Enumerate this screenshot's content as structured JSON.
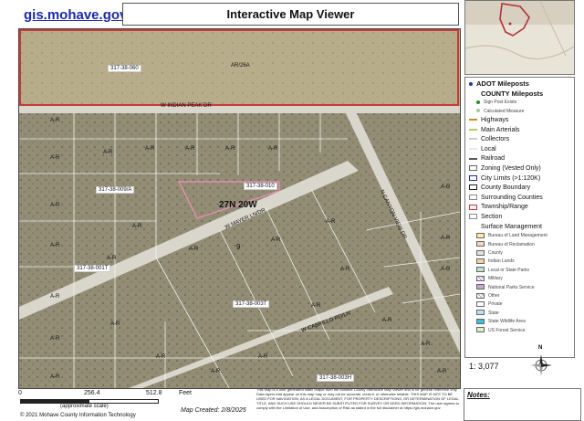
{
  "header": {
    "site_link": "gis.mohave.gov",
    "title": "Interactive Map Viewer"
  },
  "map": {
    "labels": {
      "parcel_top": "317-38-060",
      "ar26a": "AR/26A",
      "indian_peak": "W INDIAN PEAK DR",
      "parcel_010": "317-38-010",
      "parcel_mid": "317-38-009/A",
      "twp": "27N 20W",
      "mayer": "W MAYER LN/DR",
      "mohave_dr": "N CANYON VIEW DR",
      "parcel_011": "317-38-001T",
      "parcel_003": "317-38-003T",
      "cabrillo": "W CABRILLO RD/LN",
      "parcel_bottom": "317-38-003H",
      "section": "9",
      "ar": "A-R"
    }
  },
  "legend": {
    "items": [
      {
        "label": "ADOT Mileposts",
        "kind": "dot",
        "color": "#1a3aa8",
        "head": true
      },
      {
        "label": "COUNTY Mileposts",
        "kind": "none",
        "head": true
      },
      {
        "label": "Sign Post Exists",
        "kind": "dot",
        "color": "#2b8a2b",
        "sub": true
      },
      {
        "label": "Calculated Measure",
        "kind": "dot",
        "color": "#9acd9a",
        "sub": true
      },
      {
        "label": "Highways",
        "kind": "line",
        "color": "#d08a2a"
      },
      {
        "label": "Main Arterials",
        "kind": "line",
        "color": "#b7c96b"
      },
      {
        "label": "Collectors",
        "kind": "line",
        "color": "#cccccc"
      },
      {
        "label": "Local",
        "kind": "line",
        "color": "#e8e8e8"
      },
      {
        "label": "Railroad",
        "kind": "line",
        "color": "#555555"
      },
      {
        "label": "Zoning (Vested Only)",
        "kind": "box",
        "color": "#ffffff"
      },
      {
        "label": "City Limits (>1:120K)",
        "kind": "box",
        "color": "#ffffff",
        "border": "#1a2aa8"
      },
      {
        "label": "County Boundary",
        "kind": "box",
        "color": "#ffffff",
        "border": "#222222"
      },
      {
        "label": "Surrounding Counties",
        "kind": "box",
        "color": "#ffffff",
        "border": "#888888"
      },
      {
        "label": "Township/Range",
        "kind": "box",
        "color": "#ffffff",
        "border": "#cc3333"
      },
      {
        "label": "Section",
        "kind": "box",
        "color": "#ffffff",
        "border": "#888888"
      },
      {
        "label": "Surface Management",
        "kind": "none"
      },
      {
        "label": "Bureau of Land Management",
        "kind": "box",
        "color": "#fde9a8",
        "sub": true
      },
      {
        "label": "Bureau of Reclamation",
        "kind": "box",
        "color": "#fcd3b8",
        "sub": true
      },
      {
        "label": "County",
        "kind": "box",
        "color": "#e3e3e3",
        "sub": true
      },
      {
        "label": "Indian Lands",
        "kind": "box",
        "color": "#f6d2a2",
        "sub": true
      },
      {
        "label": "Local or State Parks",
        "kind": "box",
        "color": "#bfe3c8",
        "sub": true
      },
      {
        "label": "Military",
        "kind": "hatch",
        "color": "#b58ad8",
        "sub": true
      },
      {
        "label": "National Parks Service",
        "kind": "box",
        "color": "#c8a6d4",
        "sub": true
      },
      {
        "label": "Other",
        "kind": "hatch",
        "color": "#aaaaaa",
        "sub": true
      },
      {
        "label": "Private",
        "kind": "box",
        "color": "#ffffff",
        "sub": true
      },
      {
        "label": "State",
        "kind": "box",
        "color": "#b8e4ef",
        "sub": true
      },
      {
        "label": "State Wildlife Area",
        "kind": "box",
        "color": "#39c2d7",
        "sub": true
      },
      {
        "label": "US Forest Service",
        "kind": "box",
        "color": "#d9efc7",
        "sub": true
      }
    ]
  },
  "scale": {
    "ratio": "1: 3,077",
    "tick0": "0",
    "tick1": "256.4",
    "tick2": "512.8",
    "unit": "Feet",
    "approx": "(approximate scale)"
  },
  "north_label": "N",
  "map_created": "Map Created: 2/8/2025",
  "copyright": "© 2021 Mohave County Information Technology",
  "disclaimer": "This map is a user generated static output from the Mohave County Interactive Map Viewer and is for general reference only. Data layers that appear on this map may or may not be accurate, current, or otherwise reliable. THIS MAP IS NOT TO BE USED FOR NAVIGATION, AS A LEGAL DOCUMENT, FOR PROPERTY DESCRIPTIONS, OR DETERMINATION OF LEGAL TITLE, AND SUCH USE SHOULD NEVER BE SUBSTITUTED FOR SURVEY OR DEED INFORMATION. The user agrees to comply with the Limitation of Use, and Assumption of Risk as stated in the full disclaimer at https://gis.mohave.gov",
  "notes_label": "Notes:",
  "colors": {
    "terrain": "#8f8a72",
    "road": "#d9d6cc",
    "parcel_line": "#f2f2ee",
    "twp_line": "#c83a3a",
    "highlight": "#e38fb2"
  }
}
